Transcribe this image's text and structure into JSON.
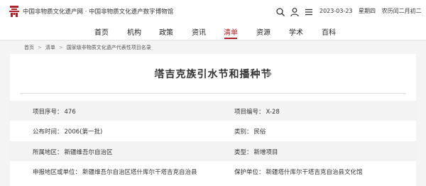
{
  "header": {
    "site_title": "中国非物质文化遗产网 · 中国非物质文化遗产数字博物馆",
    "date": "2023-03-23",
    "weekday": "星期四",
    "lunar": "农历闰二月初二"
  },
  "nav": {
    "items": [
      "首页",
      "机构",
      "政策",
      "资讯",
      "清单",
      "资源",
      "学术",
      "百科"
    ],
    "active": "清单"
  },
  "breadcrumb": {
    "items": [
      "首页",
      "清单",
      "国家级非物质文化遗产代表性项目名录"
    ]
  },
  "project": {
    "title": "塔吉克族引水节和播种节",
    "fields": [
      {
        "label": "项目序号：",
        "value": "476"
      },
      {
        "label": "项目编号：",
        "value": "X-28"
      },
      {
        "label": "公布时间：",
        "value": "2006(第一批)"
      },
      {
        "label": "类别：",
        "value": "民俗"
      },
      {
        "label": "所属地区：",
        "value": "新疆维吾尔自治区"
      },
      {
        "label": "类型：",
        "value": "新增项目"
      },
      {
        "label": "申报地区或单位：",
        "value": "新疆维吾尔自治区塔什库尔干塔吉克自治县"
      },
      {
        "label": "保护单位：",
        "value": "新疆塔什库尔干塔吉克自治县文化馆"
      }
    ]
  },
  "colors": {
    "accent": "#a8262b",
    "background": "#f4f4f4",
    "row_shade": "#f3f3f3"
  },
  "icons": [
    "logo-icon",
    "search-icon",
    "user-icon",
    "menu-icon"
  ]
}
